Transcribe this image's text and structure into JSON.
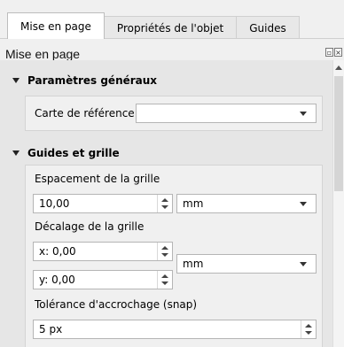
{
  "tabs": [
    {
      "label": "Mise en page",
      "active": true
    },
    {
      "label": "Propriétés de l'objet",
      "active": false
    },
    {
      "label": "Guides",
      "active": false
    }
  ],
  "panel": {
    "title": "Mise en page"
  },
  "general": {
    "header": "Paramètres généraux",
    "reference_map_label": "Carte de référence",
    "reference_map_value": ""
  },
  "guides": {
    "header": "Guides et grille",
    "spacing_label": "Espacement de la grille",
    "spacing_value": "10,00",
    "spacing_unit": "mm",
    "offset_label": "Décalage de la grille",
    "offset_x": "x: 0,00",
    "offset_y": "y: 0,00",
    "offset_unit": "mm",
    "snap_label": "Tolérance d'accrochage (snap)",
    "snap_value": "5 px"
  }
}
